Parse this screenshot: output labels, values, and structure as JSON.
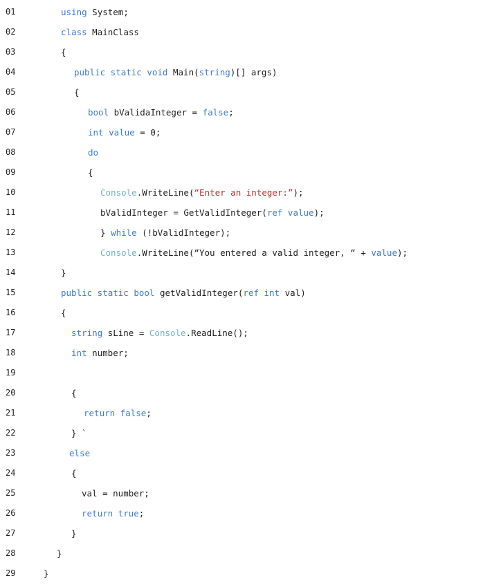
{
  "colors": {
    "keyword": "#3b7bd4",
    "type": "#6fb4c4",
    "string": "#c4302b",
    "text": "#1e1e1e"
  },
  "code": {
    "lines": [
      {
        "num": "01",
        "indent": 88,
        "tokens": [
          [
            "k",
            "using"
          ],
          [
            "p",
            " System;"
          ]
        ]
      },
      {
        "num": "02",
        "indent": 88,
        "tokens": [
          [
            "k",
            "class"
          ],
          [
            "p",
            " MainClass"
          ]
        ]
      },
      {
        "num": "03",
        "indent": 88,
        "tokens": [
          [
            "p",
            "{"
          ]
        ]
      },
      {
        "num": "04",
        "indent": 107,
        "tokens": [
          [
            "k",
            "public static void"
          ],
          [
            "p",
            " Main("
          ],
          [
            "k",
            "string"
          ],
          [
            "p",
            ")[] args)"
          ]
        ]
      },
      {
        "num": "05",
        "indent": 107,
        "tokens": [
          [
            "p",
            "{"
          ]
        ]
      },
      {
        "num": "06",
        "indent": 127,
        "tokens": [
          [
            "k",
            "bool"
          ],
          [
            "p",
            " bValidaInteger = "
          ],
          [
            "k",
            "false"
          ],
          [
            "p",
            ";"
          ]
        ]
      },
      {
        "num": "07",
        "indent": 127,
        "tokens": [
          [
            "k",
            "int"
          ],
          [
            "p",
            " "
          ],
          [
            "k",
            "value"
          ],
          [
            "p",
            " = 0;"
          ]
        ]
      },
      {
        "num": "08",
        "indent": 127,
        "tokens": [
          [
            "k",
            "do"
          ]
        ]
      },
      {
        "num": "09",
        "indent": 127,
        "tokens": [
          [
            "p",
            "{"
          ]
        ]
      },
      {
        "num": "10",
        "indent": 145,
        "tokens": [
          [
            "t",
            "Console"
          ],
          [
            "p",
            ".WriteLine("
          ],
          [
            "s",
            "“Enter an integer:”"
          ],
          [
            "p",
            ");"
          ]
        ]
      },
      {
        "num": "11",
        "indent": 145,
        "tokens": [
          [
            "p",
            "bValidInteger = GetValidInteger("
          ],
          [
            "k",
            "ref value"
          ],
          [
            "p",
            ");"
          ]
        ]
      },
      {
        "num": "12",
        "indent": 145,
        "tokens": [
          [
            "p",
            "} "
          ],
          [
            "k",
            "while"
          ],
          [
            "p",
            " (!bValidInteger);"
          ]
        ]
      },
      {
        "num": "13",
        "indent": 145,
        "tokens": [
          [
            "t",
            "Console"
          ],
          [
            "p",
            ".WriteLine(“You entered a valid integer, “ + "
          ],
          [
            "k",
            "value"
          ],
          [
            "p",
            ");"
          ]
        ]
      },
      {
        "num": "14",
        "indent": 88,
        "tokens": [
          [
            "p",
            "}"
          ]
        ]
      },
      {
        "num": "15",
        "indent": 88,
        "tokens": [
          [
            "k",
            "public static bool"
          ],
          [
            "p",
            " getValidInteger("
          ],
          [
            "k",
            "ref int"
          ],
          [
            "p",
            " val)"
          ]
        ]
      },
      {
        "num": "16",
        "indent": 88,
        "tokens": [
          [
            "p",
            "{"
          ]
        ]
      },
      {
        "num": "17",
        "indent": 103,
        "tokens": [
          [
            "k",
            "string"
          ],
          [
            "p",
            " sLine = "
          ],
          [
            "t",
            "Console"
          ],
          [
            "p",
            ".ReadLine();"
          ]
        ]
      },
      {
        "num": "18",
        "indent": 103,
        "tokens": [
          [
            "k",
            "int"
          ],
          [
            "p",
            " number;"
          ]
        ]
      },
      {
        "num": "19",
        "indent": 103,
        "tokens": []
      },
      {
        "num": "20",
        "indent": 103,
        "tokens": [
          [
            "p",
            "{"
          ]
        ]
      },
      {
        "num": "21",
        "indent": 121,
        "tokens": [
          [
            "k",
            "return false"
          ],
          [
            "p",
            ";"
          ]
        ]
      },
      {
        "num": "22",
        "indent": 103,
        "tokens": [
          [
            "p",
            "} `"
          ]
        ]
      },
      {
        "num": "23",
        "indent": 100,
        "tokens": [
          [
            "k",
            "else"
          ]
        ]
      },
      {
        "num": "24",
        "indent": 103,
        "tokens": [
          [
            "p",
            "{"
          ]
        ]
      },
      {
        "num": "25",
        "indent": 118,
        "tokens": [
          [
            "p",
            "val = number;"
          ]
        ]
      },
      {
        "num": "26",
        "indent": 118,
        "tokens": [
          [
            "k",
            "return true"
          ],
          [
            "p",
            ";"
          ]
        ]
      },
      {
        "num": "27",
        "indent": 103,
        "tokens": [
          [
            "p",
            "}"
          ]
        ]
      },
      {
        "num": "28",
        "indent": 82,
        "tokens": [
          [
            "p",
            "}"
          ]
        ]
      },
      {
        "num": "29",
        "indent": 63,
        "tokens": [
          [
            "p",
            "}"
          ]
        ]
      }
    ]
  }
}
